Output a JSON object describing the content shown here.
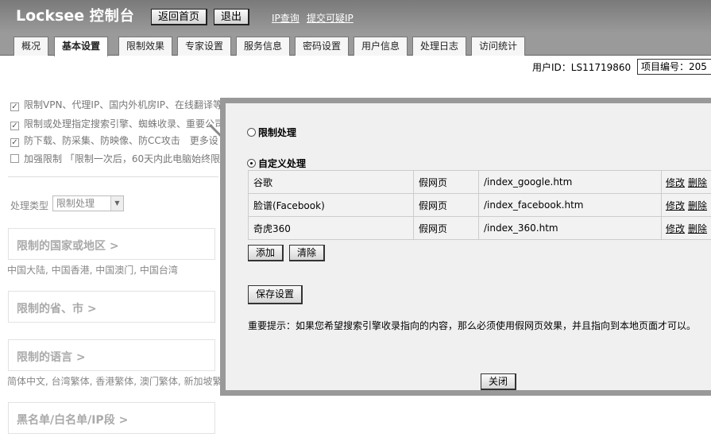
{
  "header": {
    "logo_text": "Locksee",
    "logo_cn": "控制台",
    "home_button": "返回首页",
    "logout_button": "退出",
    "ip_query_link": "IP查询",
    "report_ip_link": "提交可疑IP"
  },
  "tabs": [
    {
      "label": "概况"
    },
    {
      "label": "基本设置"
    },
    {
      "label": "限制效果"
    },
    {
      "label": "专家设置"
    },
    {
      "label": "服务信息"
    },
    {
      "label": "密码设置"
    },
    {
      "label": "用户信息"
    },
    {
      "label": "处理日志"
    },
    {
      "label": "访问统计"
    }
  ],
  "userbar": {
    "user_id_label": "用户ID：",
    "user_id": "LS11719860",
    "project_label": "项目编号：205"
  },
  "background": {
    "options": [
      {
        "label": "限制VPN、代理IP、国内外机房IP、在线翻译等",
        "checked": true
      },
      {
        "label": "限制或处理指定搜索引擎、蜘蛛收录、重要公司",
        "checked": true
      },
      {
        "label": "防下载、防采集、防映像、防CC攻击　更多设",
        "checked": true
      },
      {
        "label": "加强限制 「限制一次后，60天内此电脑始终限",
        "checked": false
      }
    ],
    "process_type_label": "处理类型",
    "process_type_value": "限制处理",
    "sections": [
      {
        "title": "限制的国家或地区 >",
        "sub": "中国大陆, 中国香港, 中国澳门, 中国台湾"
      },
      {
        "title": "限制的省、市 >",
        "sub": ""
      },
      {
        "title": "限制的语言 >",
        "sub": "简体中文, 台湾繁体, 香港繁体, 澳门繁体, 新加坡繁"
      },
      {
        "title": "黑名单/白名单/IP段 >",
        "sub": ""
      }
    ]
  },
  "modal": {
    "radio_limit": "限制处理",
    "radio_custom": "自定义处理",
    "selected": "custom",
    "rows": [
      {
        "name": "谷歌",
        "type": "假网页",
        "path": "/index_google.htm"
      },
      {
        "name": "脸谱(Facebook)",
        "type": "假网页",
        "path": "/index_facebook.htm"
      },
      {
        "name": "奇虎360",
        "type": "假网页",
        "path": "/index_360.htm"
      }
    ],
    "edit_label": "修改",
    "delete_label": "删除",
    "add_button": "添加",
    "clear_button": "清除",
    "save_button": "保存设置",
    "notice": "重要提示：如果您希望搜索引擎收录指向的内容，那么必须使用假网页效果，并且指向到本地页面才可以。",
    "close_button": "关闭"
  }
}
